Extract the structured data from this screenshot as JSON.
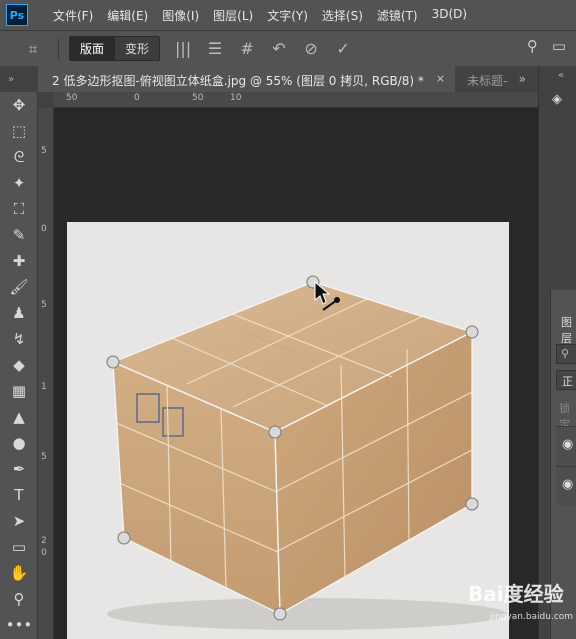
{
  "app": {
    "logo_text": "Ps"
  },
  "menu": {
    "items": [
      "文件(F)",
      "编辑(E)",
      "图像(I)",
      "图层(L)",
      "文字(Y)",
      "选择(S)",
      "滤镜(T)",
      "3D(D)"
    ]
  },
  "options": {
    "mode_buttons": [
      "版面",
      "变形"
    ],
    "active_mode": "版面"
  },
  "tabs": [
    {
      "label": "2 低多边形抠图-俯视图立体纸盒.jpg @ 55% (图层 0 拷贝, RGB/8) *",
      "active": true
    },
    {
      "label": "未标题-",
      "active": false
    }
  ],
  "rulers": {
    "top": [
      "50",
      "0",
      "50",
      "10"
    ],
    "left": [
      "5",
      "0",
      "5",
      "1",
      "5",
      "2",
      "0"
    ]
  },
  "layers_panel": {
    "title": "图层",
    "mode": "正",
    "lock_label": "锁定"
  },
  "watermark": {
    "logo": "Bai度经验",
    "url": "jingyan.baidu.com"
  },
  "colors": {
    "accent": "#31a8ff",
    "panel": "#535353",
    "dark": "#282828"
  }
}
